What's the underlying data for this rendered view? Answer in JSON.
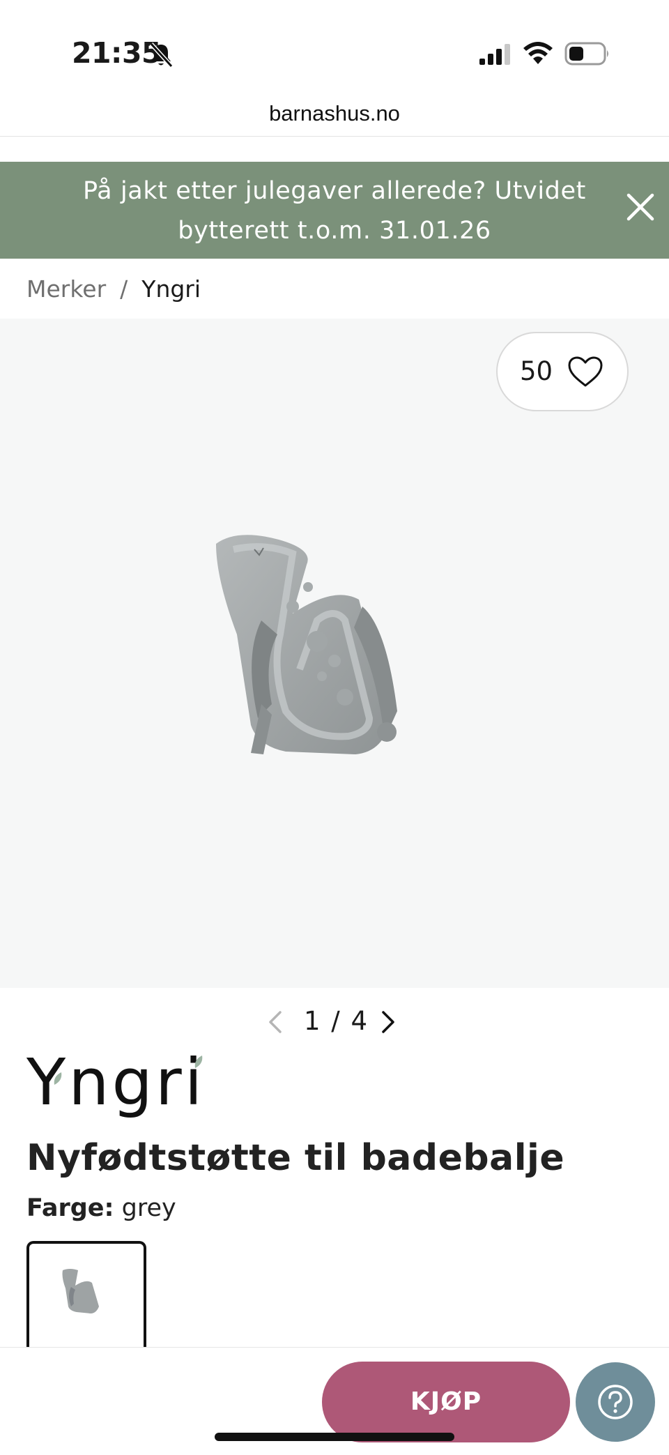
{
  "status_bar": {
    "time": "21:35",
    "icons": [
      "bell-off-icon",
      "signal-icon",
      "wifi-icon",
      "battery-icon"
    ]
  },
  "browser": {
    "url": "barnashus.no"
  },
  "promo": {
    "text": "På jakt etter julegaver allerede? Utvidet bytterett t.o.m. 31.01.26",
    "background": "#7b917a",
    "close_icon": "close-icon"
  },
  "breadcrumb": {
    "items": [
      {
        "label": "Merker"
      },
      {
        "label": "Yngri"
      }
    ],
    "separator": "/"
  },
  "gallery": {
    "wishlist_count": "50",
    "wishlist_icon": "heart-icon",
    "pager": "1 / 4",
    "current_image": 1,
    "total_images": 4
  },
  "product": {
    "brand": "Yngri",
    "title": "Nyfødtstøtte til badebalje",
    "color_label": "Farge:",
    "color_value": "grey"
  },
  "actions": {
    "buy_label": "KJØP",
    "buy_color": "#ae5877",
    "help_icon": "help-icon",
    "help_color": "#6f8e9a"
  }
}
